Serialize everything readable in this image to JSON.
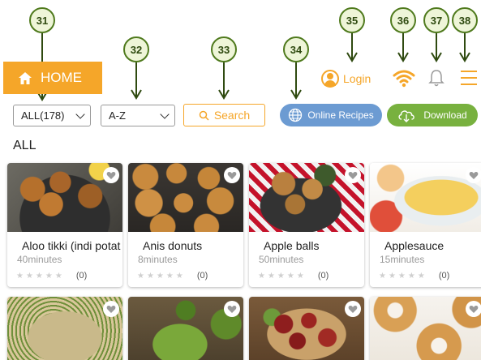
{
  "callouts": [
    "31",
    "32",
    "33",
    "34",
    "35",
    "36",
    "37",
    "38"
  ],
  "topbar": {
    "home_label": "HOME",
    "login_label": "Login",
    "accent_color": "#f5a629"
  },
  "filters": {
    "category_value": "ALL(178)",
    "sort_value": "A-Z",
    "search_label": "Search",
    "online_recipes_label": "Online Recipes",
    "download_label": "Download"
  },
  "section_title": "ALL",
  "recipes": [
    {
      "title": "Aloo tikki (indi potato",
      "time": "40minutes",
      "rating_count": "(0)"
    },
    {
      "title": "Anis donuts",
      "time": "8minutes",
      "rating_count": "(0)"
    },
    {
      "title": "Apple balls",
      "time": "50minutes",
      "rating_count": "(0)"
    },
    {
      "title": "Applesauce",
      "time": "15minutes",
      "rating_count": "(0)"
    }
  ],
  "icons": {
    "home": "home-icon",
    "user": "user-icon",
    "wifi": "wifi-icon",
    "bell": "bell-icon",
    "menu": "hamburger-menu-icon",
    "globe": "globe-icon",
    "cloud": "cloud-download-icon",
    "search": "search-icon",
    "heart": "heart-icon",
    "star": "star-icon"
  }
}
